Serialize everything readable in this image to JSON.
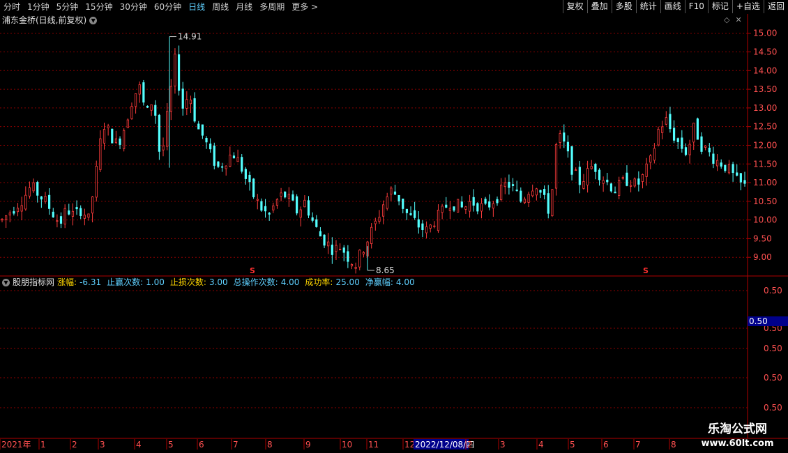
{
  "toolbar": {
    "periods": [
      "分时",
      "1分钟",
      "5分钟",
      "15分钟",
      "30分钟",
      "60分钟",
      "日线",
      "周线",
      "月线",
      "多周期",
      "更多 >"
    ],
    "active_period": "日线",
    "buttons": [
      "复权",
      "叠加",
      "多股",
      "统计",
      "画线",
      "F10",
      "标记",
      "+自选",
      "返回"
    ]
  },
  "main_panel": {
    "title": "浦东金桥(日线,前复权)",
    "high_label": "14.91",
    "low_label": "8.65",
    "signal_marker": "S"
  },
  "indicator_panel": {
    "name": "股朋指标网",
    "fields": [
      {
        "label": "涨幅:",
        "value": "-6.31",
        "label_color": "yellow",
        "value_color": "cyan"
      },
      {
        "label": "止赢次数:",
        "value": "1.00",
        "label_color": "cyan",
        "value_color": "cyan"
      },
      {
        "label": "止损次数:",
        "value": "3.00",
        "label_color": "yellow",
        "value_color": "cyan"
      },
      {
        "label": "总操作次数:",
        "value": "4.00",
        "label_color": "cyan",
        "value_color": "cyan"
      },
      {
        "label": "成功率:",
        "value": "25.00",
        "label_color": "yellow",
        "value_color": "cyan"
      },
      {
        "label": "净赢幅:",
        "value": "4.00",
        "label_color": "cyan",
        "value_color": "cyan"
      }
    ],
    "y_labels": [
      "0.50",
      "0.50",
      "0.50",
      "0.50",
      "0.50"
    ],
    "highlight_value": "0.50"
  },
  "time_axis": {
    "labels": [
      "2021年",
      "1",
      "2",
      "3",
      "4",
      "5",
      "6",
      "7",
      "8",
      "9",
      "10",
      "11",
      "12",
      "2022/12/08/四",
      "2",
      "3",
      "4",
      "5",
      "6",
      "7",
      "8"
    ],
    "cursor_label": "2022/12/08/四"
  },
  "watermark": {
    "line1": "乐淘公式网",
    "line2": "www.60lt.com"
  },
  "colors": {
    "up": "#ff3c3c",
    "down": "#54ffff",
    "grid": "#8b0000",
    "axis_text": "#ff5050",
    "signal": "#ff3030"
  },
  "chart_data": {
    "type": "candlestick",
    "y_ticks": [
      9.0,
      9.5,
      10.0,
      10.5,
      11.0,
      11.5,
      12.0,
      12.5,
      13.0,
      13.5,
      14.0,
      14.5,
      15.0
    ],
    "ylim": [
      8.5,
      15.2
    ],
    "high": 14.91,
    "low": 8.65,
    "close_path": [
      10.0,
      10.2,
      10.4,
      10.6,
      10.9,
      10.7,
      10.5,
      10.2,
      9.9,
      10.3,
      10.1,
      10.3,
      10.0,
      11.2,
      12.6,
      12.3,
      12.0,
      12.5,
      13.2,
      13.6,
      12.8,
      13.3,
      11.5,
      12.9,
      14.3,
      13.0,
      13.4,
      12.5,
      12.2,
      11.7,
      11.4,
      11.6,
      11.8,
      11.5,
      11.0,
      10.6,
      10.3,
      10.1,
      10.5,
      10.7,
      10.5,
      10.2,
      10.5,
      10.0,
      9.6,
      9.4,
      9.2,
      9.3,
      9.0,
      8.8,
      9.2,
      9.6,
      10.0,
      10.5,
      10.8,
      10.6,
      10.2,
      10.0,
      9.8,
      9.7,
      10.0,
      10.2,
      10.5,
      10.4,
      10.3,
      10.5,
      10.4,
      10.3,
      10.5,
      10.7,
      11.0,
      10.8,
      10.5,
      10.8,
      11.0,
      10.6,
      10.2,
      12.3,
      12.0,
      11.4,
      11.0,
      11.2,
      11.5,
      11.2,
      11.0,
      10.8,
      11.0,
      11.1,
      10.9,
      11.2,
      11.6,
      12.4,
      12.7,
      12.3,
      12.0,
      11.8,
      12.5,
      12.0,
      11.8,
      11.6,
      11.5,
      11.3,
      11.0,
      10.9
    ]
  }
}
